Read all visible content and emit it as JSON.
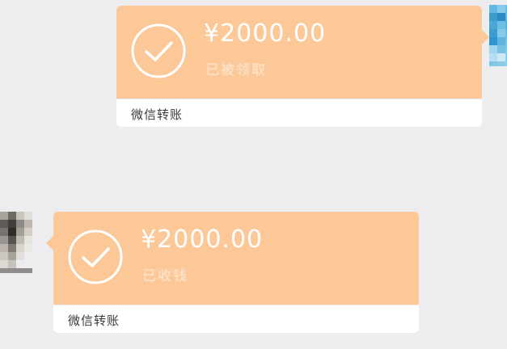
{
  "messages": [
    {
      "side": "outgoing",
      "amount": "¥2000.00",
      "status": "已被领取",
      "footer": "微信转账"
    },
    {
      "side": "incoming",
      "amount": "¥2000.00",
      "status": "已收钱",
      "footer": "微信转账"
    }
  ],
  "colors": {
    "card_body": "#fcc898",
    "card_footer": "#ffffff",
    "background": "#ededf0",
    "amount_text": "#ffffff"
  },
  "icons": {
    "status_icon": "check-circle-icon"
  }
}
